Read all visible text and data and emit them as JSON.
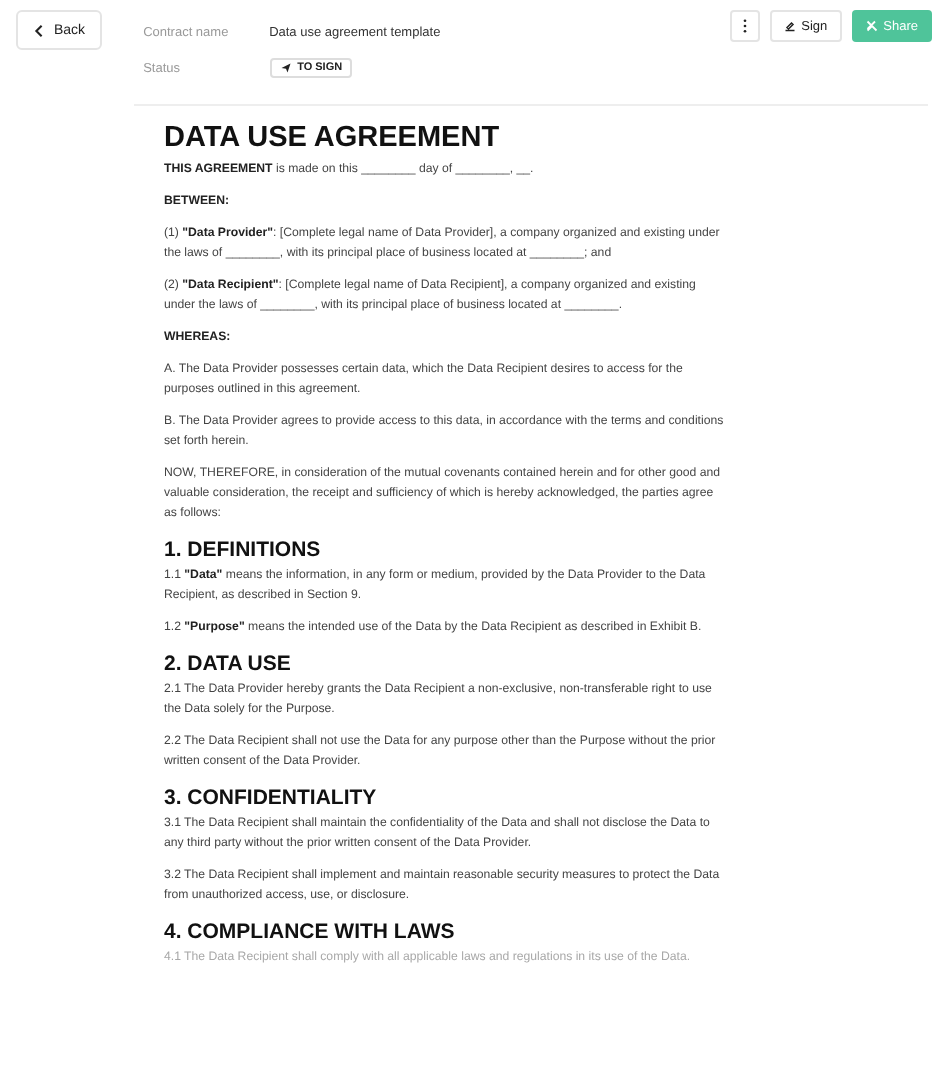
{
  "header": {
    "back_button": "Back",
    "contract_name_label": "Contract name",
    "contract_name": "Data use agreement template",
    "status_label": "Status",
    "status": "TO SIGN",
    "sign_button": "Sign",
    "share_button": "Share"
  },
  "document": [
    {
      "kind": "title",
      "text": "DATA USE AGREEMENT"
    },
    {
      "kind": "para",
      "text": "**THIS AGREEMENT** is made on this ________ day of ________, __."
    },
    {
      "kind": "para",
      "text": "**BETWEEN:**"
    },
    {
      "kind": "para",
      "text": "(1) **\"Data Provider\"**: [Complete legal name of Data Provider], a company organized and existing under the laws of ________, with its principal place of business located at ________; and"
    },
    {
      "kind": "para",
      "text": "(2) **\"Data Recipient\"**: [Complete legal name of Data Recipient], a company organized and existing under the laws of ________, with its principal place of business located at ________."
    },
    {
      "kind": "para",
      "text": "**WHEREAS:**"
    },
    {
      "kind": "para",
      "text": "A. The Data Provider possesses certain data, which the Data Recipient desires to access for the purposes outlined in this agreement."
    },
    {
      "kind": "para",
      "text": "B. The Data Provider agrees to provide access to this data, in accordance with the terms and conditions set forth herein."
    },
    {
      "kind": "para",
      "text": "NOW, THEREFORE, in consideration of the mutual covenants contained herein and for other good and valuable consideration, the receipt and sufficiency of which is hereby acknowledged, the parties agree as follows:"
    },
    {
      "kind": "heading",
      "text": "1. DEFINITIONS"
    },
    {
      "kind": "para",
      "text": "1.1 **\"Data\"** means the information, in any form or medium, provided by the Data Provider to the Data Recipient, as described in Section 9."
    },
    {
      "kind": "para",
      "text": "1.2 **\"Purpose\"** means the intended use of the Data by the Data Recipient as described in Exhibit B."
    },
    {
      "kind": "heading",
      "text": "2. DATA USE"
    },
    {
      "kind": "para",
      "text": "2.1 The Data Provider hereby grants the Data Recipient a non-exclusive, non-transferable right to use the Data solely for the Purpose."
    },
    {
      "kind": "para",
      "text": "2.2 The Data Recipient shall not use the Data for any purpose other than the Purpose without the prior written consent of the Data Provider."
    },
    {
      "kind": "heading",
      "text": "3. CONFIDENTIALITY"
    },
    {
      "kind": "para",
      "text": "3.1 The Data Recipient shall maintain the confidentiality of the Data and shall not disclose the Data to any third party without the prior written consent of the Data Provider."
    },
    {
      "kind": "para",
      "text": "3.2 The Data Recipient shall implement and maintain reasonable security measures to protect the Data from unauthorized access, use, or disclosure."
    },
    {
      "kind": "heading",
      "text": "4. COMPLIANCE WITH LAWS"
    },
    {
      "kind": "faded",
      "text": "4.1 The Data Recipient shall comply with all applicable laws and regulations in its use of the Data."
    }
  ]
}
